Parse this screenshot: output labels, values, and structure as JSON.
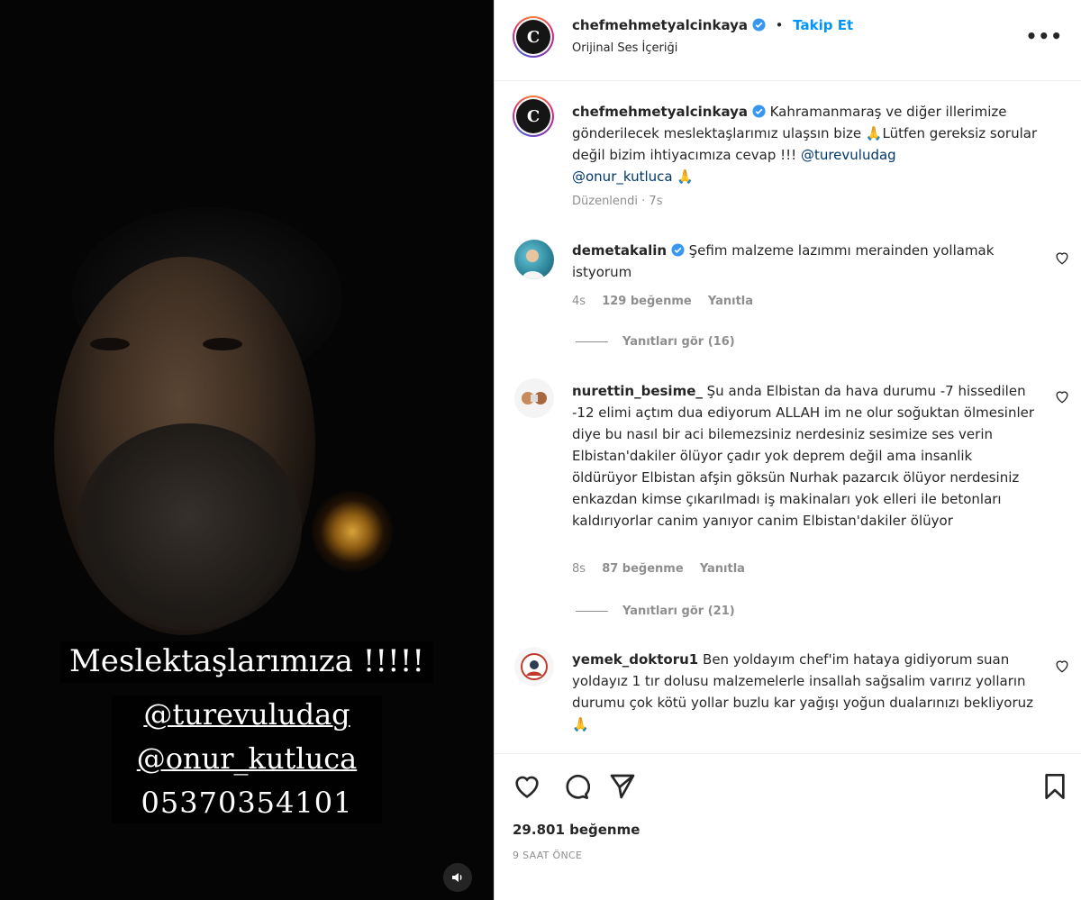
{
  "media": {
    "caption_title": "Meslektaşlarımıza !!!!!",
    "caption_lines": [
      "@turevuludag",
      "@onur_kutluca",
      "05370354101"
    ]
  },
  "header": {
    "username": "chefmehmetyalcinkaya",
    "separator": "•",
    "follow_label": "Takip Et",
    "subtitle": "Orijinal Ses İçeriği",
    "avatar_letter": "C",
    "more_label": "•••"
  },
  "post": {
    "username": "chefmehmetyalcinkaya",
    "text": "Kahramanmaraş ve diğer illerimize gönderilecek meslektaşlarımız ulaşsın bize 🙏Lütfen gereksiz sorular değil bizim ihtiyacımıza cevap !!! ",
    "mention1": "@turevuludag",
    "mention2": "@onur_kutluca",
    "emoji_end": " 🙏",
    "edited": "Düzenlendi · 7s"
  },
  "comments": [
    {
      "username": "demetakalin",
      "text": "Şefim malzeme lazımmı merainden yollamak istyorum",
      "time": "4s",
      "likes": "129 beğenme",
      "reply": "Yanıtla",
      "view_replies": "Yanıtları gör (16)"
    },
    {
      "username": "nurettin_besime_",
      "text": "Şu anda Elbistan da hava durumu -7 hissedilen -12 elimi açtım dua ediyorum ALLAH im ne olur soğuktan ölmesinler diye bu nasıl bir aci bilemezsiniz nerdesiniz sesimize ses verin Elbistan'dakiler ölüyor çadır yok deprem değil ama insanlik öldürüyor Elbistan afşin göksün Nurhak pazarcık ölüyor nerdesiniz enkazdan kimse çıkarılmadı iş makinaları yok elleri ile betonları kaldırıyorlar canim yanıyor canim Elbistan'dakiler ölüyor",
      "time": "8s",
      "likes": "87 beğenme",
      "reply": "Yanıtla",
      "view_replies": "Yanıtları gör (21)"
    },
    {
      "username": "yemek_doktoru1",
      "text": "Ben yoldayım chef'im hataya gidiyorum suan yoldayız 1 tır dolusu malzemelerle insallah sağsalim varırız yolların durumu çok kötü yollar buzlu kar yağışı yoğun dualarınızı bekliyoruz 🙏"
    }
  ],
  "footer": {
    "likes": "29.801 beğenme",
    "time_ago": "9 SAAT ÖNCE"
  },
  "colors": {
    "accent": "#0095f6",
    "mention": "#00376b",
    "muted": "#8e8e8e",
    "verified": "#3897f0"
  }
}
